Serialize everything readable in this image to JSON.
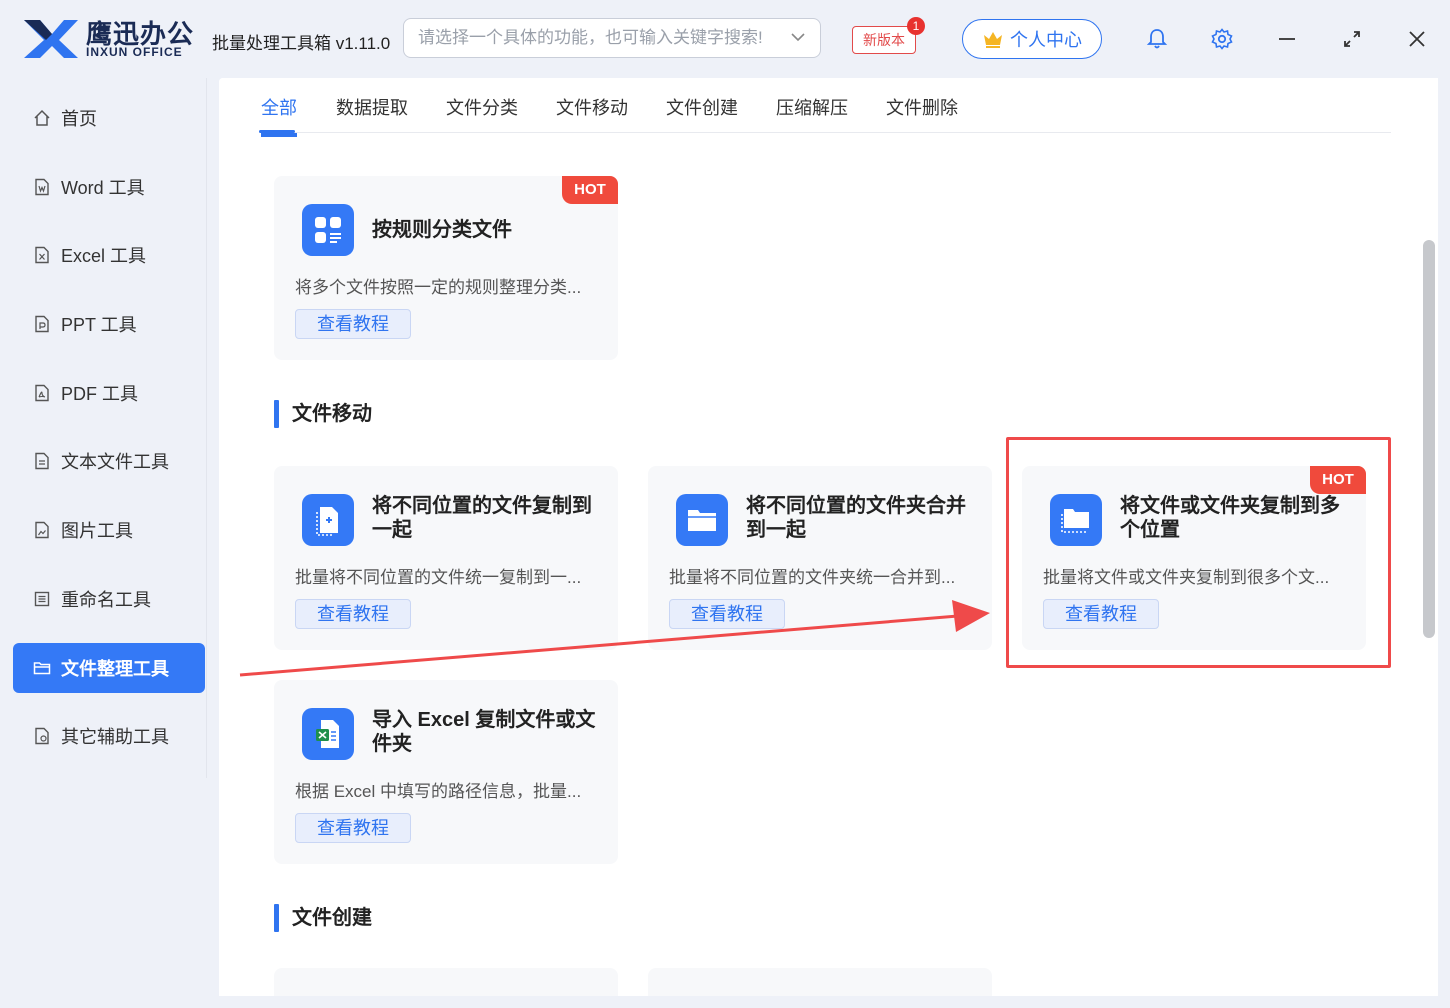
{
  "app": {
    "logo_cn": "鹰迅办公",
    "logo_en": "INXUN OFFICE",
    "title": "批量处理工具箱 v1.11.0",
    "search_placeholder": "请选择一个具体的功能，也可输入关键字搜索!",
    "new_version_label": "新版本",
    "new_version_badge": "1",
    "personal_center_label": "个人中心"
  },
  "sidebar": {
    "items": [
      {
        "label": "首页",
        "icon": "home-icon"
      },
      {
        "label": "Word 工具",
        "icon": "word-file-icon"
      },
      {
        "label": "Excel 工具",
        "icon": "excel-file-icon"
      },
      {
        "label": "PPT 工具",
        "icon": "ppt-file-icon"
      },
      {
        "label": "PDF 工具",
        "icon": "pdf-file-icon"
      },
      {
        "label": "文本文件工具",
        "icon": "text-file-icon"
      },
      {
        "label": "图片工具",
        "icon": "image-file-icon"
      },
      {
        "label": "重命名工具",
        "icon": "rename-icon"
      },
      {
        "label": "文件整理工具",
        "icon": "folder-icon",
        "active": true
      },
      {
        "label": "其它辅助工具",
        "icon": "tools-icon"
      }
    ]
  },
  "tabs": [
    "全部",
    "数据提取",
    "文件分类",
    "文件移动",
    "文件创建",
    "压缩解压",
    "文件删除"
  ],
  "active_tab": "全部",
  "sections": {
    "move": {
      "title": "文件移动"
    },
    "create": {
      "title": "文件创建"
    }
  },
  "cards": {
    "classify": {
      "title": "按规则分类文件",
      "desc": "将多个文件按照一定的规则整理分类...",
      "button": "查看教程",
      "badge": "HOT"
    },
    "copy_files_together": {
      "title": "将不同位置的文件复制到一起",
      "desc": "批量将不同位置的文件统一复制到一...",
      "button": "查看教程"
    },
    "merge_folders": {
      "title": "将不同位置的文件夹合并到一起",
      "desc": "批量将不同位置的文件夹统一合并到...",
      "button": "查看教程"
    },
    "copy_to_multiple": {
      "title": "将文件或文件夹复制到多个位置",
      "desc": "批量将文件或文件夹复制到很多个文...",
      "button": "查看教程",
      "badge": "HOT"
    },
    "import_excel": {
      "title": "导入 Excel 复制文件或文件夹",
      "desc": "根据 Excel 中填写的路径信息，批量...",
      "button": "查看教程"
    }
  },
  "colors": {
    "accent": "#2f74f0",
    "hot_badge": "#f04a3c",
    "highlight": "#ef4a4a"
  }
}
